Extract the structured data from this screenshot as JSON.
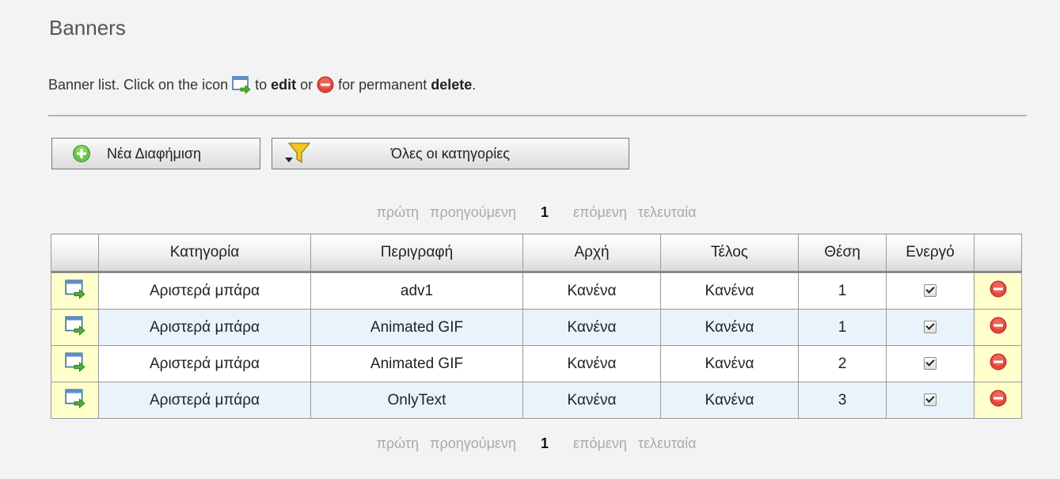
{
  "page": {
    "title": "Banners"
  },
  "intro": {
    "prefix": "Banner list. Click on the icon",
    "to": "to",
    "edit_word": "edit",
    "or": "or",
    "for": "for permanent",
    "delete_word": "delete",
    "period": "."
  },
  "toolbar": {
    "new_label": "Νέα Διαφήμιση",
    "filter_label": "Όλες οι κατηγορίες"
  },
  "pager": {
    "first": "πρώτη",
    "previous": "προηγούμενη",
    "current": "1",
    "next": "επόμενη",
    "last": "τελευταία"
  },
  "table": {
    "columns": [
      "",
      "Κατηγορία",
      "Περιγραφή",
      "Αρχή",
      "Τέλος",
      "Θέση",
      "Ενεργό",
      ""
    ],
    "rows": [
      {
        "category": "Αριστερά μπάρα",
        "description": "adv1",
        "start": "Κανένα",
        "end": "Κανένα",
        "position": "1",
        "active": true
      },
      {
        "category": "Αριστερά μπάρα",
        "description": "Animated GIF",
        "start": "Κανένα",
        "end": "Κανένα",
        "position": "1",
        "active": true
      },
      {
        "category": "Αριστερά μπάρα",
        "description": "Animated GIF",
        "start": "Κανένα",
        "end": "Κανένα",
        "position": "2",
        "active": true
      },
      {
        "category": "Αριστερά μπάρα",
        "description": "OnlyText",
        "start": "Κανένα",
        "end": "Κανένα",
        "position": "3",
        "active": true
      }
    ]
  },
  "icons": {
    "edit": "edit-window-arrow-icon",
    "delete": "delete-minus-circle-icon",
    "add": "add-plus-circle-icon",
    "filter": "funnel-filter-icon"
  }
}
